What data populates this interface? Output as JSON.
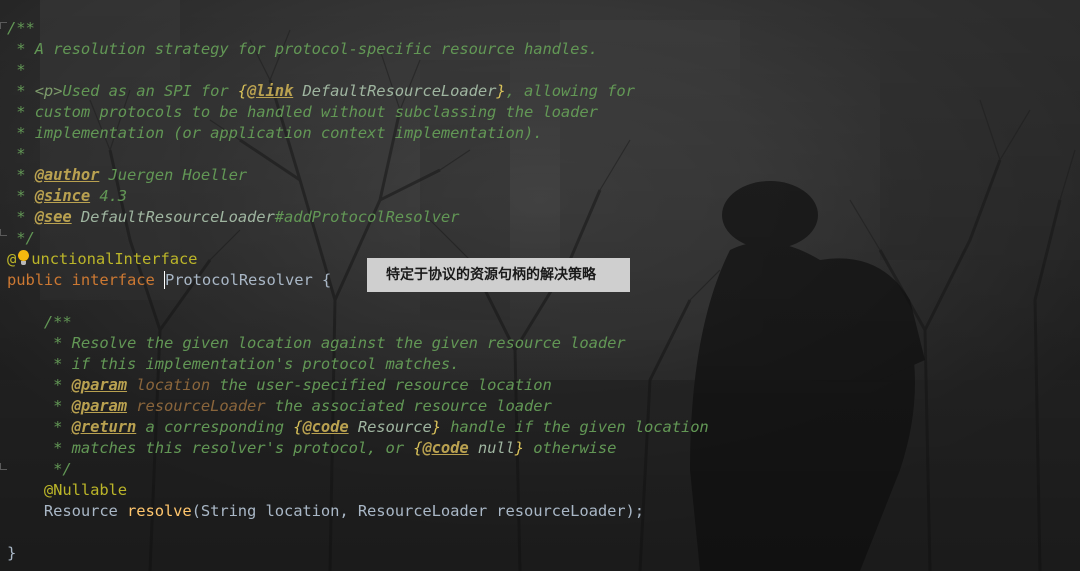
{
  "tooltip": {
    "text": "特定于协议的资源句柄的解决策略"
  },
  "code": {
    "l1": "/**",
    "l2": " * A resolution strategy for protocol-specific resource handles.",
    "l3": " *",
    "l4_a": " * ",
    "l4_p": "<p>",
    "l4_b": "Used as an SPI for ",
    "l4_ob": "{",
    "l4_tag": "@link",
    "l4_ref": " DefaultResourceLoader",
    "l4_cb": "}",
    "l4_c": ", allowing for",
    "l5": " * custom protocols to be handled without subclassing the loader",
    "l6": " * implementation (or application context implementation).",
    "l7": " *",
    "l8_a": " * ",
    "l8_tag": "@author",
    "l8_b": " Juergen Hoeller",
    "l9_a": " * ",
    "l9_tag": "@since",
    "l9_b": " 4.3",
    "l10_a": " * ",
    "l10_tag": "@see",
    "l10_ref": " DefaultResourceLoader",
    "l10_b": "#addProtocolResolver",
    "l11": " */",
    "l12_a": "@",
    "l12_b": "unctionalInterface",
    "l13_kw1": "public",
    "l13_kw2": " interface ",
    "l13_name": "ProtocolResolver",
    "l13_brace": " {",
    "m1": "    /**",
    "m2": "     * Resolve the given location against the given resource loader",
    "m3": "     * if this implementation's protocol matches.",
    "m4_a": "     * ",
    "m4_tag": "@param",
    "m4_pn": " location",
    "m4_b": " the user-specified resource location",
    "m5_a": "     * ",
    "m5_tag": "@param",
    "m5_pn": " resourceLoader",
    "m5_b": " the associated resource loader",
    "m6_a": "     * ",
    "m6_tag": "@return",
    "m6_b": " a corresponding ",
    "m6_ob": "{",
    "m6_code": "@code",
    "m6_ref": " Resource",
    "m6_cb": "}",
    "m6_c": " handle if the given location",
    "m7_a": "     * matches this resolver's protocol, or ",
    "m7_ob": "{",
    "m7_code": "@code",
    "m7_ref": " null",
    "m7_cb": "}",
    "m7_c": " otherwise",
    "m8": "     */",
    "m9": "    @Nullable",
    "m10_type": "    Resource ",
    "m10_fn": "resolve",
    "m10_args": "(String location, ResourceLoader resourceLoader);",
    "end": "}"
  }
}
